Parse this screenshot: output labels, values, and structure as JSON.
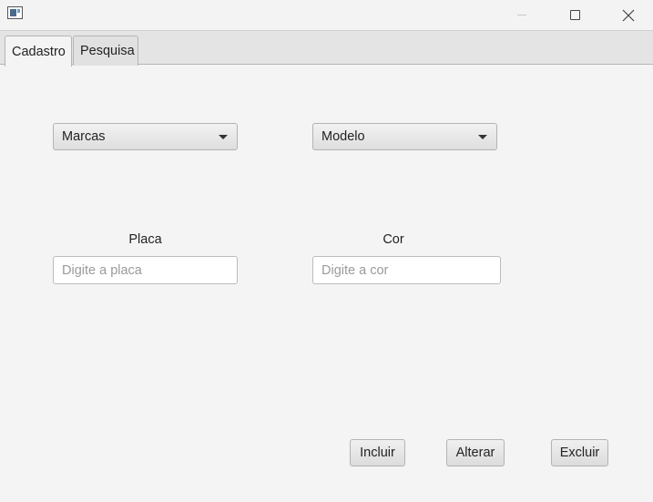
{
  "window": {
    "controls": {
      "minimize_icon": "minimize-icon",
      "maximize_icon": "maximize-icon",
      "close_icon": "close-icon"
    }
  },
  "tabs": [
    {
      "label": "Cadastro",
      "selected": true
    },
    {
      "label": "Pesquisa",
      "selected": false
    }
  ],
  "form": {
    "marcas": {
      "value": "Marcas"
    },
    "modelo": {
      "value": "Modelo"
    },
    "placa": {
      "label": "Placa",
      "placeholder": "Digite a placa",
      "value": ""
    },
    "cor": {
      "label": "Cor",
      "placeholder": "Digite a cor",
      "value": ""
    }
  },
  "actions": {
    "incluir": "Incluir",
    "alterar": "Alterar",
    "excluir": "Excluir"
  }
}
